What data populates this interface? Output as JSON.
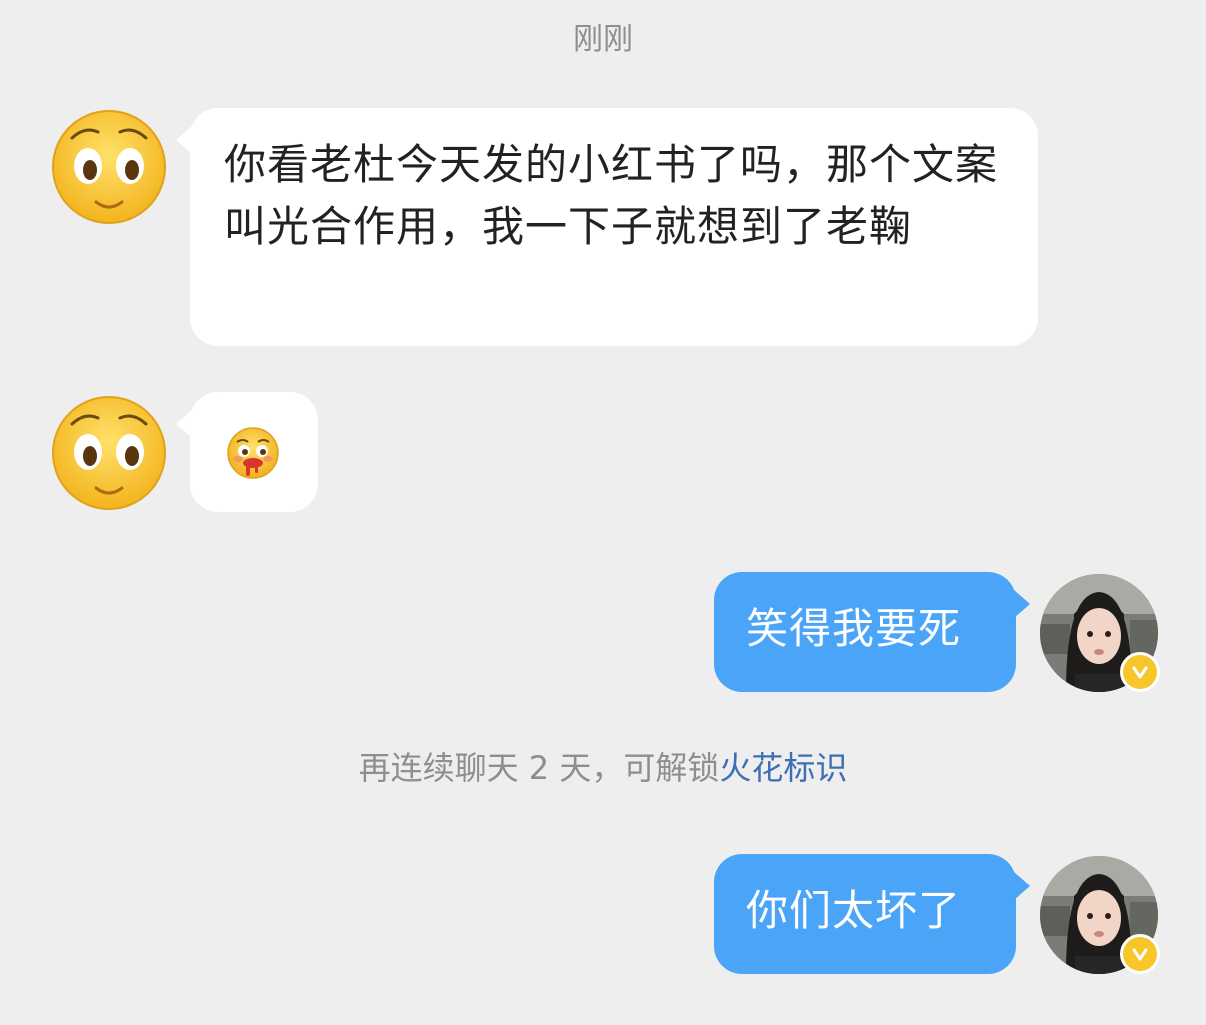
{
  "header": {
    "timestamp": "刚刚"
  },
  "messages": [
    {
      "side": "left",
      "text": "你看老杜今天发的小红书了吗，那个文案叫光合作用，我一下子就想到了老鞠",
      "avatar": "smiley-face-avatar"
    },
    {
      "side": "left",
      "emoji": "drooling-face-icon",
      "avatar": "smiley-face-avatar"
    },
    {
      "side": "right",
      "text": "笑得我要死",
      "avatar": "user-photo-avatar"
    },
    {
      "side": "right",
      "text": "你们太坏了",
      "avatar": "user-photo-avatar"
    }
  ],
  "system_note": {
    "prefix": "再连续聊天 2 天，可解锁",
    "link": "火花标识"
  },
  "colors": {
    "background": "#eeeeee",
    "left_bubble": "#ffffff",
    "right_bubble": "#4aa4f8",
    "link": "#3e6fb4",
    "meta_text": "#8e8e8e",
    "badge": "#f7c62b"
  }
}
